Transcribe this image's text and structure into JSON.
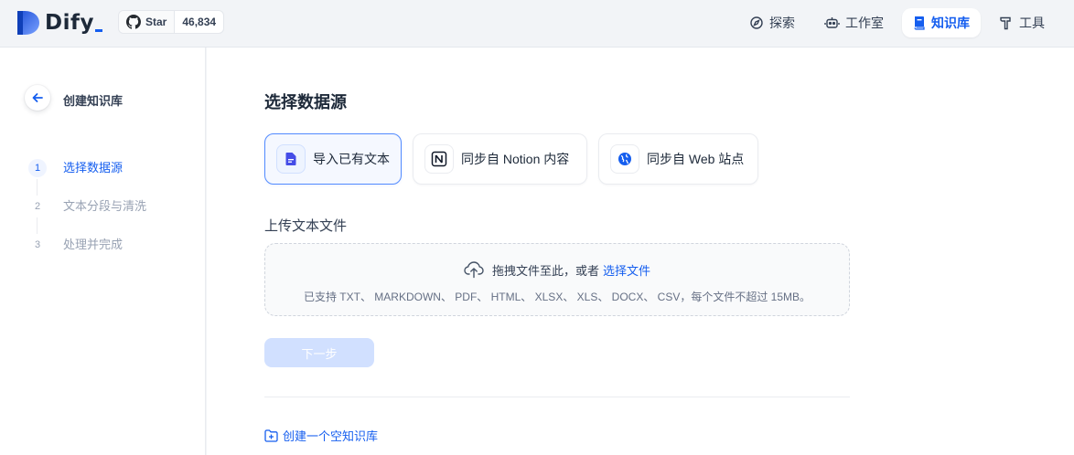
{
  "header": {
    "logo_text": "Dify",
    "github": {
      "star_label": "Star",
      "star_count": "46,834"
    },
    "nav": [
      {
        "label": "探索",
        "icon": "explore-icon"
      },
      {
        "label": "工作室",
        "icon": "robot-icon"
      },
      {
        "label": "知识库",
        "icon": "book-icon",
        "active": true
      },
      {
        "label": "工具",
        "icon": "hammer-icon"
      }
    ]
  },
  "sidebar": {
    "title": "创建知识库",
    "steps": [
      {
        "num": "1",
        "label": "选择数据源",
        "active": true
      },
      {
        "num": "2",
        "label": "文本分段与清洗"
      },
      {
        "num": "3",
        "label": "处理并完成"
      }
    ]
  },
  "main": {
    "section_title": "选择数据源",
    "sources": [
      {
        "label": "导入已有文本",
        "icon": "file-text-icon",
        "active": true
      },
      {
        "label": "同步自 Notion 内容",
        "icon": "notion-icon"
      },
      {
        "label": "同步自 Web 站点",
        "icon": "globe-icon"
      }
    ],
    "upload_title": "上传文本文件",
    "dropzone": {
      "text": "拖拽文件至此，或者",
      "link": "选择文件",
      "hint": "已支持 TXT、 MARKDOWN、 PDF、 HTML、 XLSX、 XLS、 DOCX、 CSV，每个文件不超过 15MB。"
    },
    "next_button": "下一步",
    "create_empty": "创建一个空知识库"
  },
  "colors": {
    "accent": "#155eef",
    "text": "#1d2939",
    "muted": "#98a2b3"
  }
}
